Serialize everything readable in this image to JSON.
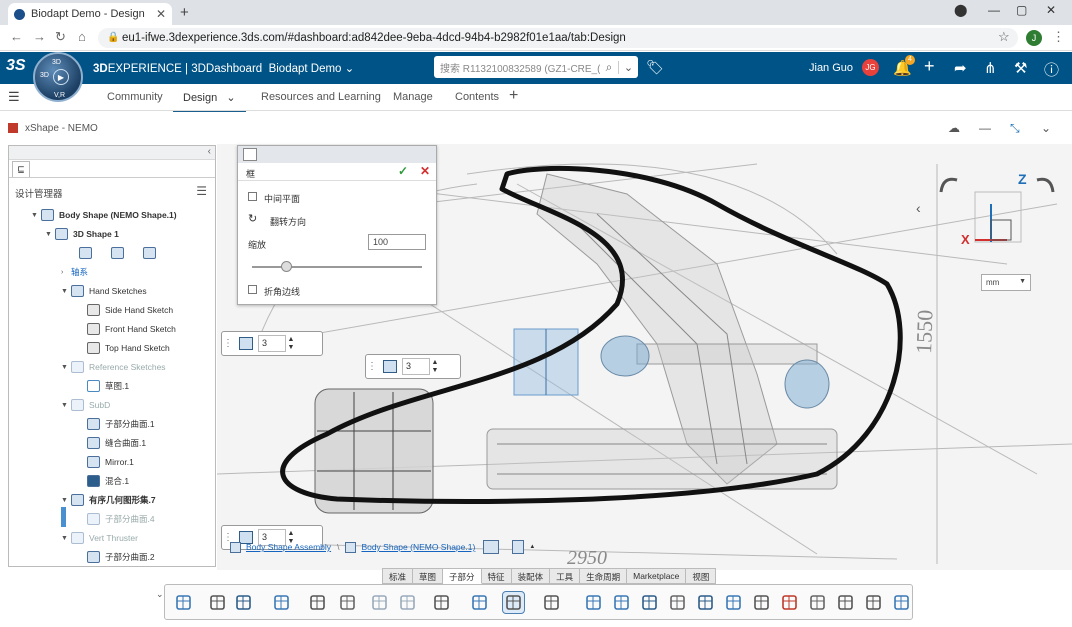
{
  "browser": {
    "tab_title": "Biodapt Demo - Design",
    "url": "eu1-ifwe.3dexperience.3ds.com/#dashboard:ad842dee-9eba-4dcd-94b4-b2982f01e1aa/tab:Design",
    "profile_initial": "J"
  },
  "topbar": {
    "brand_bold": "3D",
    "brand_rest": "EXPERIENCE | 3DDashboard",
    "dashboard_name": "Biodapt Demo",
    "search_placeholder": "搜索 R1132100832589 (GZ1-CRE_(",
    "user_name": "Jian Guo",
    "user_initials": "JG",
    "notification_count": "4",
    "compass": {
      "top": "3D",
      "left": "3D",
      "center": "V,R",
      "bottom": "V,R"
    },
    "colors": {
      "bar": "#005386",
      "avatar": "#e8413c"
    }
  },
  "tabs": {
    "items": [
      "Community",
      "Design",
      "Resources and Learning",
      "Manage",
      "Contents"
    ],
    "active": "Design"
  },
  "app": {
    "title": "xShape - NEMO"
  },
  "tree": {
    "manager_label": "设计管理器",
    "items": [
      {
        "label": "Body Shape (NEMO Shape.1)"
      },
      {
        "label": "3D Shape 1"
      },
      {
        "label": "轴系"
      },
      {
        "label": "Hand Sketches"
      },
      {
        "label": "Side Hand Sketch"
      },
      {
        "label": "Front Hand Sketch"
      },
      {
        "label": "Top Hand Sketch"
      },
      {
        "label": "Reference Sketches"
      },
      {
        "label": "草图.1"
      },
      {
        "label": "SubD"
      },
      {
        "label": "子部分曲面.1"
      },
      {
        "label": "缝合曲面.1"
      },
      {
        "label": "Mirror.1"
      },
      {
        "label": "混合.1"
      },
      {
        "label": "有序几何图形集.7"
      },
      {
        "label": "子部分曲面.4"
      },
      {
        "label": "Vert Thruster"
      },
      {
        "label": "子部分曲面.2"
      }
    ]
  },
  "dialog": {
    "title": "框",
    "option_mid_plane": "中间平面",
    "option_flip": "翻转方向",
    "scale_label": "缩放",
    "scale_value": "100",
    "option_fold": "折角边线",
    "slider_level": 0.2
  },
  "viewport": {
    "spinners": [
      "3",
      "3",
      "3"
    ],
    "unit": "mm",
    "dim_vertical": "1550",
    "dim_horizontal": "2950",
    "axis_z": "Z",
    "axis_x": "X"
  },
  "breadcrumb": [
    "Body Shape Assembly",
    "Body Shape (NEMO Shape.1)"
  ],
  "bottom_tabs": {
    "items": [
      "标准",
      "草图",
      "子部分",
      "特征",
      "装配体",
      "工具",
      "生命周期",
      "Marketplace",
      "视图"
    ],
    "active": "子部分"
  },
  "action_bar": {
    "icons": [
      "part-icon",
      "shape-icon",
      "save-icon",
      "refresh-icon",
      "copy-icon",
      "settings-icon",
      "undo-icon",
      "redo-icon",
      "help-icon",
      "grid-icon",
      "box-icon",
      "mesh-icon",
      "pyramid-icon",
      "curve-icon",
      "face-icon",
      "extrude-icon",
      "fit-icon",
      "panel-icon",
      "lamp-icon",
      "cube-icon",
      "bend-icon",
      "sphere-icon",
      "twist-icon",
      "cutter-icon"
    ]
  }
}
